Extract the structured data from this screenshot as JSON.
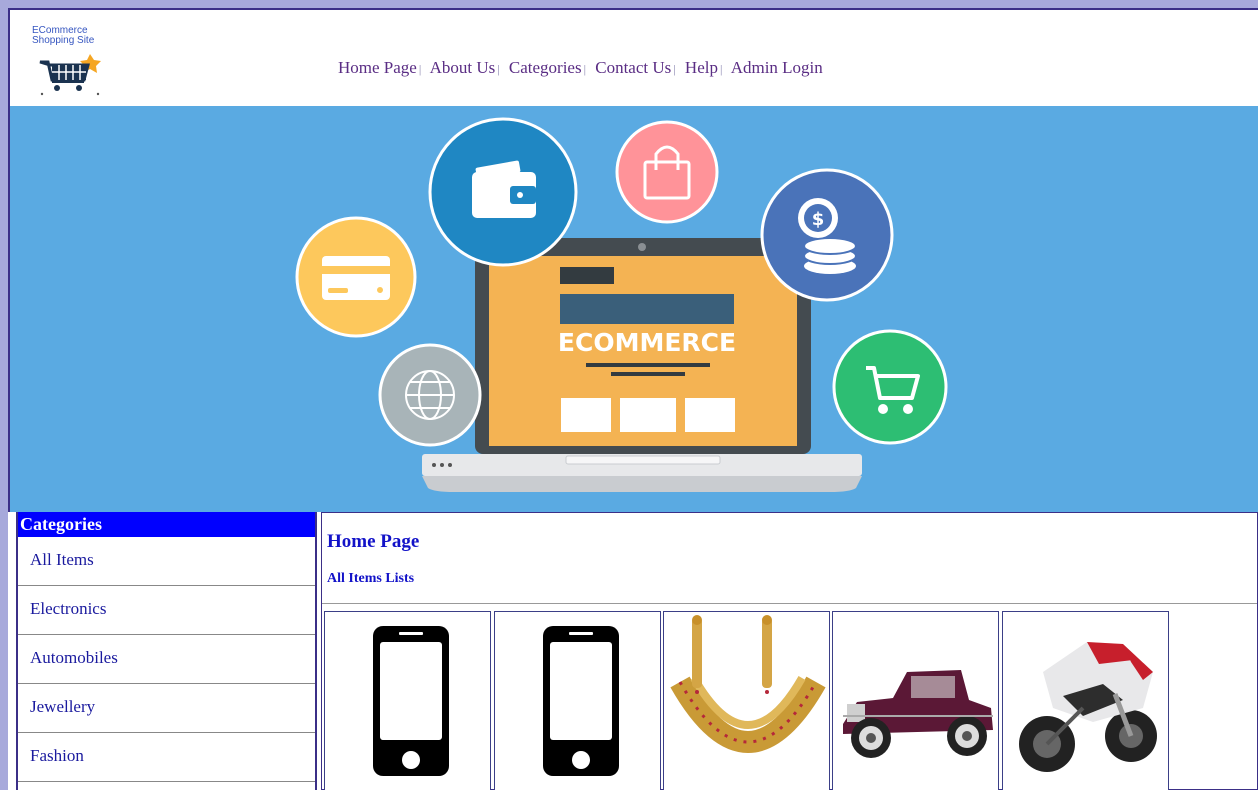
{
  "logo": {
    "line1": "ECommerce",
    "line2": "Shopping Site"
  },
  "nav": [
    {
      "label": "Home Page"
    },
    {
      "label": "About Us"
    },
    {
      "label": "Categories"
    },
    {
      "label": "Contact Us"
    },
    {
      "label": "Help"
    },
    {
      "label": "Admin Login"
    }
  ],
  "nav_separator": "|",
  "banner": {
    "laptop_text": "ECOMMERCE"
  },
  "sidebar": {
    "title": "Categories",
    "items": [
      {
        "label": "All Items"
      },
      {
        "label": "Electronics"
      },
      {
        "label": "Automobiles"
      },
      {
        "label": "Jewellery"
      },
      {
        "label": "Fashion"
      }
    ]
  },
  "main": {
    "title": "Home Page",
    "subtitle": "All Items Lists"
  },
  "products": [
    {
      "icon": "smartphone-icon"
    },
    {
      "icon": "smartphone-icon"
    },
    {
      "icon": "jewellery-necklace-image"
    },
    {
      "icon": "vintage-car-image"
    },
    {
      "icon": "motorbike-image"
    }
  ],
  "colors": {
    "page_bg": "#a7a9db",
    "banner_bg": "#5aaae2",
    "sidebar_title_bg": "#0000ff",
    "link": "#5a2d84",
    "heading": "#1212c8"
  }
}
